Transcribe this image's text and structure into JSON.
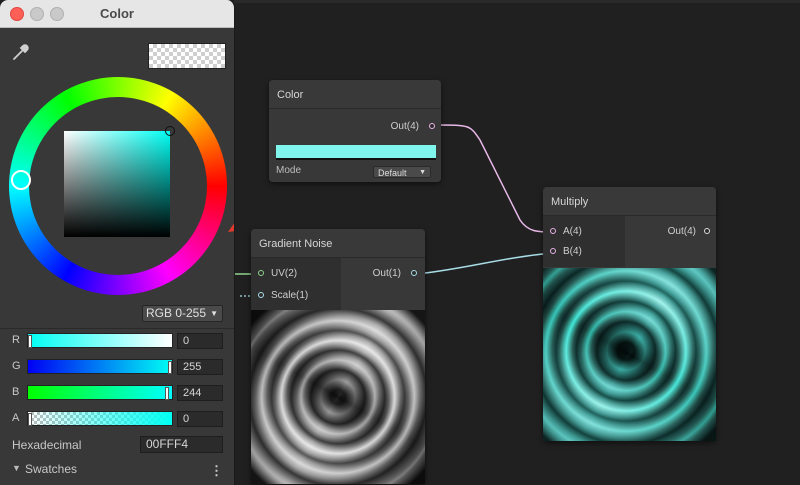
{
  "picker": {
    "title": "Color",
    "mode_label": "RGB 0-255",
    "channels": [
      {
        "label": "R",
        "value": "0",
        "level": 0.0
      },
      {
        "label": "G",
        "value": "255",
        "level": 1.0
      },
      {
        "label": "B",
        "value": "244",
        "level": 0.957
      },
      {
        "label": "A",
        "value": "0",
        "level": 0.0
      }
    ],
    "hex_label": "Hexadecimal",
    "hex_value": "00FFF4",
    "swatches_label": "Swatches",
    "current_color": "#00FFF4"
  },
  "nodes": {
    "color": {
      "title": "Color",
      "out_port": "Out(4)",
      "mode_label": "Mode",
      "mode_value": "Default",
      "swatch_color": "#7ff5ee"
    },
    "gradient_noise": {
      "title": "Gradient Noise",
      "in_ports": [
        "UV(2)",
        "Scale(1)"
      ],
      "out_port": "Out(1)"
    },
    "multiply": {
      "title": "Multiply",
      "in_ports": [
        "A(4)",
        "B(4)"
      ],
      "out_port": "Out(4)"
    }
  },
  "colors": {
    "accent_arrow": "#e23b2e",
    "edge_pink": "#e6b3e6",
    "edge_cyan": "#a8dde8"
  }
}
